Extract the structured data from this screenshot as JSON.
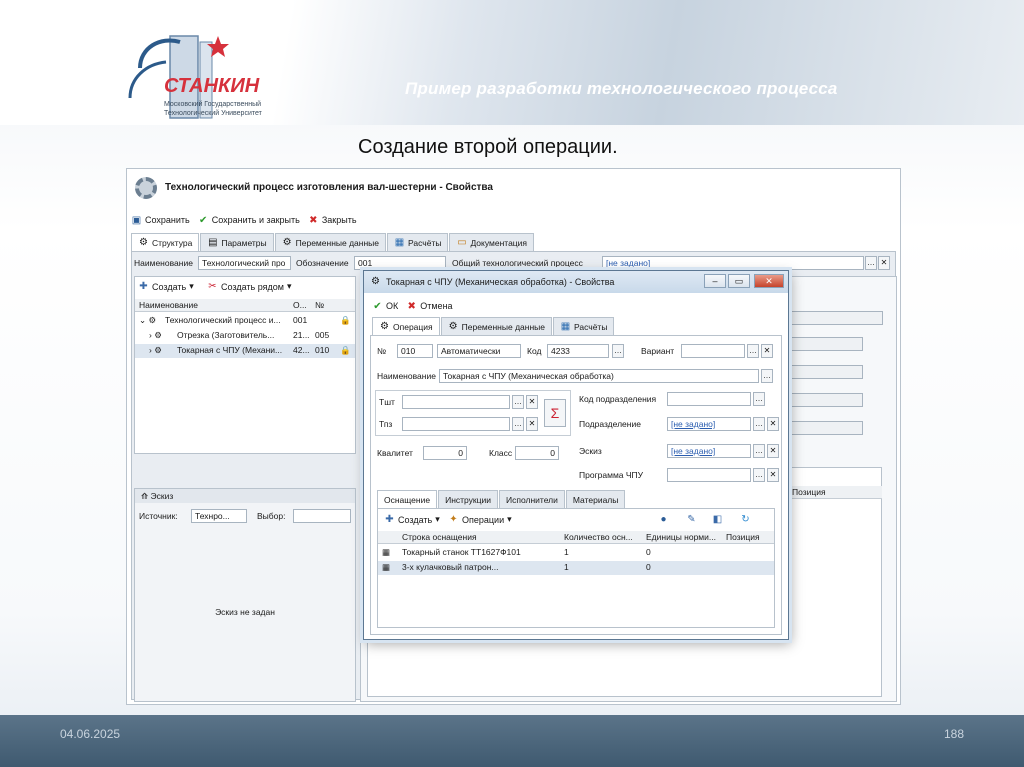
{
  "slide": {
    "title": "Пример разработки технологического процесса",
    "subtitle": "Создание второй операции.",
    "date": "04.06.2025",
    "page": "188",
    "logo_text": "СТАНКИН",
    "logo_sub1": "Московский Государственный",
    "logo_sub2": "Технологический Университет"
  },
  "main": {
    "title": "Технологический процесс изготовления вал-шестерни - Свойства",
    "toolbar": {
      "save": "Сохранить",
      "save_close": "Сохранить и закрыть",
      "close": "Закрыть"
    },
    "tabs": [
      "Структура",
      "Параметры",
      "Переменные данные",
      "Расчёты",
      "Документация"
    ],
    "name_label": "Наименование",
    "name_value": "Технологический про",
    "designation_label": "Обозначение",
    "designation_value": "001",
    "general_label": "Общий технологический процесс",
    "general_value": "[не задано]",
    "tree": {
      "create": "Создать",
      "create_near": "Создать рядом",
      "col_name": "Наименование",
      "col_o": "О...",
      "col_no": "№",
      "rows": [
        {
          "name": "Технологический процесс и...",
          "o": "001",
          "no": ""
        },
        {
          "name": "Отрезка (Заготовитель...",
          "o": "21...",
          "no": "005"
        },
        {
          "name": "Токарная с ЧПУ (Механи...",
          "o": "42...",
          "no": "010"
        }
      ]
    },
    "sketch": {
      "title": "Эскиз",
      "source_label": "Источник:",
      "source_value": "Технро...",
      "select_label": "Выбор:",
      "empty": "Эскиз не задан"
    },
    "bg_grid_col": "Позиция"
  },
  "dialog": {
    "title": "Токарная с ЧПУ (Механическая обработка) - Свойства",
    "ok": "ОК",
    "cancel": "Отмена",
    "tabs": [
      "Операция",
      "Переменные данные",
      "Расчёты"
    ],
    "no_label": "№",
    "no_value": "010",
    "auto_value": "Автоматически",
    "code_label": "Код",
    "code_value": "4233",
    "variant_label": "Вариант",
    "name_label": "Наименование",
    "name_value": "Токарная с ЧПУ (Механическая обработка)",
    "tsht_label": "Тшт",
    "tpz_label": "Тпз",
    "sigma": "Σ",
    "dept_code_label": "Код подразделения",
    "dept_label": "Подразделение",
    "dept_value": "[не задано]",
    "sketch_label": "Эскиз",
    "sketch_value": "[не задано]",
    "program_label": "Программа ЧПУ",
    "kvalitet_label": "Квалитет",
    "kvalitet_value": "0",
    "class_label": "Класс",
    "class_value": "0",
    "subtabs": [
      "Оснащение",
      "Инструкции",
      "Исполнители",
      "Материалы"
    ],
    "create": "Создать",
    "operations": "Операции",
    "cols": [
      "Строка оснащения",
      "Количество осн...",
      "Единицы норми...",
      "Позиция"
    ],
    "rows": [
      {
        "name": "Токарный станок ТТ1627Ф101",
        "qty": "1",
        "unit": "0",
        "pos": ""
      },
      {
        "name": "3-х кулачковый патрон...",
        "qty": "1",
        "unit": "0",
        "pos": ""
      }
    ]
  }
}
